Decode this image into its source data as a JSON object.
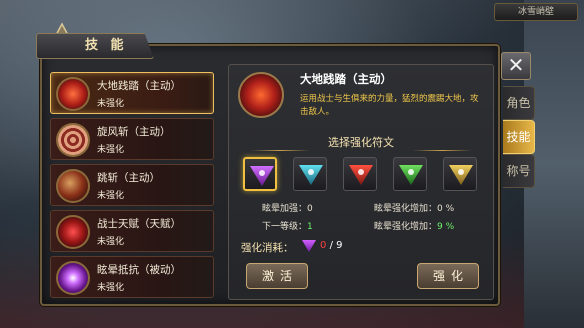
{
  "map": {
    "label": "冰雪峭壁"
  },
  "panel": {
    "title": "技 能"
  },
  "side_tabs": [
    {
      "label": "角色",
      "active": false
    },
    {
      "label": "技能",
      "active": true
    },
    {
      "label": "称号",
      "active": false
    }
  ],
  "skills": [
    {
      "name": "大地践踏（主动）",
      "state": "未强化",
      "selected": true,
      "icon": "earth-stomp-icon"
    },
    {
      "name": "旋风斩（主动）",
      "state": "未强化",
      "selected": false,
      "icon": "whirlwind-icon"
    },
    {
      "name": "跳斩（主动）",
      "state": "未强化",
      "selected": false,
      "icon": "leap-strike-icon"
    },
    {
      "name": "战士天赋（天赋）",
      "state": "未强化",
      "selected": false,
      "icon": "warrior-talent-icon"
    },
    {
      "name": "眩晕抵抗（被动）",
      "state": "未强化",
      "selected": false,
      "icon": "stun-resist-icon"
    }
  ],
  "detail": {
    "name": "大地践踏（主动）",
    "description": "运用战士与生俱来的力量，猛烈的震踢大地，攻击敌人。",
    "section_title": "选择强化符文",
    "runes": [
      {
        "name": "purple-rune-icon",
        "color": "#a040d0",
        "selected": true
      },
      {
        "name": "cyan-rune-icon",
        "color": "#30b0c0",
        "selected": false
      },
      {
        "name": "red-rune-icon",
        "color": "#d03028",
        "selected": false
      },
      {
        "name": "green-rune-icon",
        "color": "#40b040",
        "selected": false
      },
      {
        "name": "yellow-rune-icon",
        "color": "#c8a030",
        "selected": false
      }
    ],
    "stats": {
      "stun_boost_label": "眩晕加强：",
      "stun_boost_value": "0",
      "stun_rate_label": "眩晕强化增加：",
      "stun_rate_value": "0 %",
      "next_level_label": "下一等级：",
      "next_level_value": "1",
      "stun_rate_next_label": "眩晕强化增加：",
      "stun_rate_next_value": "9 %"
    },
    "cost": {
      "label": "强化消耗：",
      "have": "0",
      "need": "/ 9"
    },
    "buttons": {
      "activate": "激活",
      "enhance": "强化"
    }
  },
  "close": {
    "label": "✕"
  }
}
